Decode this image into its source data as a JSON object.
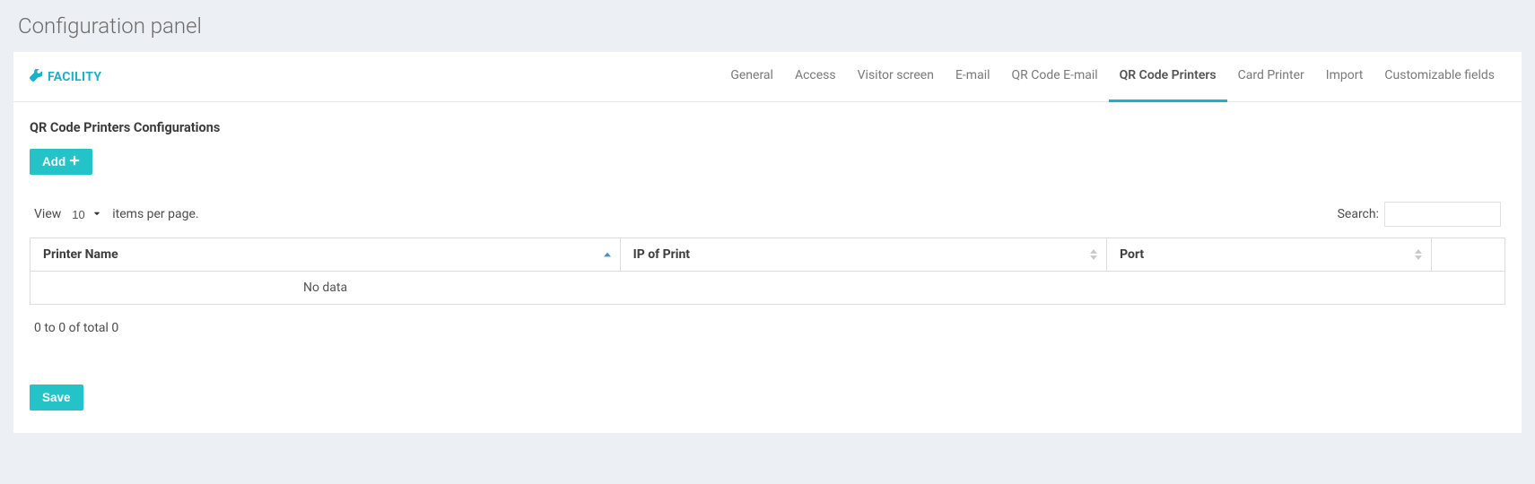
{
  "page_title": "Configuration panel",
  "header": {
    "facility_label": "FACILITY",
    "tabs": [
      {
        "label": "General",
        "active": false
      },
      {
        "label": "Access",
        "active": false
      },
      {
        "label": "Visitor screen",
        "active": false
      },
      {
        "label": "E-mail",
        "active": false
      },
      {
        "label": "QR Code E-mail",
        "active": false
      },
      {
        "label": "QR Code Printers",
        "active": true
      },
      {
        "label": "Card Printer",
        "active": false
      },
      {
        "label": "Import",
        "active": false
      },
      {
        "label": "Customizable fields",
        "active": false
      }
    ]
  },
  "section": {
    "title": "QR Code Printers Configurations",
    "add_button_label": "Add"
  },
  "controls": {
    "view_label": "View",
    "items_per_page_label": "items per page.",
    "items_per_page_value": "10",
    "search_label": "Search:",
    "search_value": ""
  },
  "table": {
    "columns": [
      {
        "label": "Printer Name",
        "sort": "asc"
      },
      {
        "label": "IP of Print",
        "sort": "both"
      },
      {
        "label": "Port",
        "sort": "both"
      },
      {
        "label": "",
        "sort": "none"
      }
    ],
    "empty_text": "No data",
    "rows": []
  },
  "pagination_info": "0 to 0 of total 0",
  "save_button_label": "Save"
}
